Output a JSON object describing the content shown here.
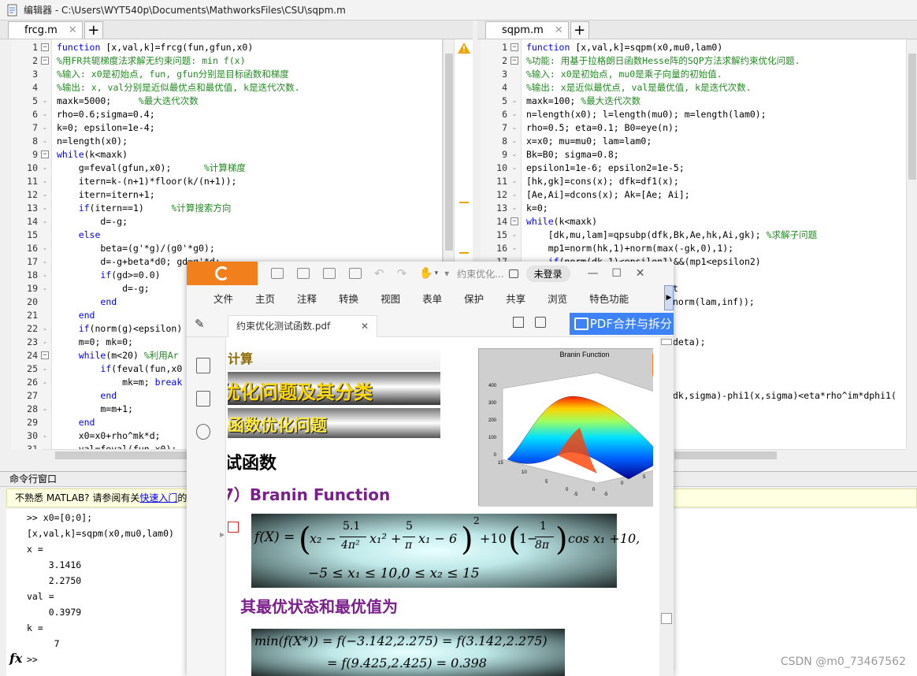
{
  "window": {
    "title": "编辑器 - C:\\Users\\WYT540p\\Documents\\MathworksFiles\\CSU\\sqpm.m"
  },
  "left_editor": {
    "tab": "frcg.m",
    "lines": [
      {
        "n": "1",
        "fold": "box",
        "t": [
          [
            "kw",
            "function"
          ],
          [
            "tx",
            " [x,val,k]=frcg(fun,gfun,x0)"
          ]
        ]
      },
      {
        "n": "2",
        "fold": "box",
        "t": [
          [
            "cm",
            "%用FR共轭梯度法求解无约束问题: min f(x)"
          ]
        ]
      },
      {
        "n": "3",
        "fold": "",
        "t": [
          [
            "cm",
            "%输入: x0是初始点, fun, gfun分别是目标函数和梯度"
          ]
        ]
      },
      {
        "n": "4",
        "fold": "",
        "t": [
          [
            "cm",
            "%输出: x, val分别是近似最优点和最优值, k是迭代次数."
          ]
        ]
      },
      {
        "n": "5",
        "fold": "dash",
        "t": [
          [
            "tx",
            "maxk=5000;     "
          ],
          [
            "cm",
            "%最大迭代次数"
          ]
        ]
      },
      {
        "n": "6",
        "fold": "dash",
        "t": [
          [
            "tx",
            "rho=0.6;sigma=0.4;"
          ]
        ]
      },
      {
        "n": "7",
        "fold": "dash",
        "t": [
          [
            "tx",
            "k=0; epsilon=1e-4;"
          ]
        ]
      },
      {
        "n": "8",
        "fold": "dash",
        "t": [
          [
            "tx",
            "n=length(x0);"
          ]
        ]
      },
      {
        "n": "9",
        "fold": "box",
        "t": [
          [
            "kw",
            "while"
          ],
          [
            "tx",
            "(k<maxk)"
          ]
        ]
      },
      {
        "n": "10",
        "fold": "dash",
        "t": [
          [
            "tx",
            "    g=feval(gfun,x0);      "
          ],
          [
            "cm",
            "%计算梯度"
          ]
        ]
      },
      {
        "n": "11",
        "fold": "dash",
        "t": [
          [
            "tx",
            "    itern=k-(n+1)*floor(k/(n+1));"
          ]
        ]
      },
      {
        "n": "12",
        "fold": "dash",
        "t": [
          [
            "tx",
            "    itern=itern+1;"
          ]
        ]
      },
      {
        "n": "13",
        "fold": "dash",
        "t": [
          [
            "tx",
            "    "
          ],
          [
            "kw",
            "if"
          ],
          [
            "tx",
            "(itern==1)     "
          ],
          [
            "cm",
            "%计算搜索方向"
          ]
        ]
      },
      {
        "n": "14",
        "fold": "dash",
        "t": [
          [
            "tx",
            "        d=-g;"
          ]
        ]
      },
      {
        "n": "15",
        "fold": "",
        "t": [
          [
            "tx",
            "    "
          ],
          [
            "kw",
            "else"
          ]
        ]
      },
      {
        "n": "16",
        "fold": "dash",
        "t": [
          [
            "tx",
            "        beta=(g'*g)/(g0'*g0);"
          ]
        ]
      },
      {
        "n": "17",
        "fold": "dash",
        "t": [
          [
            "tx",
            "        d=-g+beta*d0; gd=g'*d;"
          ]
        ]
      },
      {
        "n": "18",
        "fold": "dash",
        "t": [
          [
            "tx",
            "        "
          ],
          [
            "kw",
            "if"
          ],
          [
            "tx",
            "(gd>=0.0)"
          ]
        ]
      },
      {
        "n": "19",
        "fold": "dash",
        "t": [
          [
            "tx",
            "            d=-g;"
          ]
        ]
      },
      {
        "n": "20",
        "fold": "",
        "t": [
          [
            "tx",
            "        "
          ],
          [
            "kw",
            "end"
          ]
        ]
      },
      {
        "n": "21",
        "fold": "",
        "t": [
          [
            "tx",
            "    "
          ],
          [
            "kw",
            "end"
          ]
        ]
      },
      {
        "n": "22",
        "fold": "dash",
        "t": [
          [
            "tx",
            "    "
          ],
          [
            "kw",
            "if"
          ],
          [
            "tx",
            "(norm(g)<epsilon)"
          ]
        ]
      },
      {
        "n": "23",
        "fold": "dash",
        "t": [
          [
            "tx",
            "    m=0; mk=0;"
          ]
        ]
      },
      {
        "n": "24",
        "fold": "box",
        "t": [
          [
            "tx",
            "    "
          ],
          [
            "kw",
            "while"
          ],
          [
            "tx",
            "(m<20) "
          ],
          [
            "cm",
            "%利用Ar"
          ]
        ]
      },
      {
        "n": "25",
        "fold": "dash",
        "t": [
          [
            "tx",
            "        "
          ],
          [
            "kw",
            "if"
          ],
          [
            "tx",
            "(feval(fun,x0"
          ]
        ]
      },
      {
        "n": "26",
        "fold": "dash",
        "t": [
          [
            "tx",
            "            mk=m; "
          ],
          [
            "kw",
            "break"
          ]
        ]
      },
      {
        "n": "27",
        "fold": "",
        "t": [
          [
            "tx",
            "        "
          ],
          [
            "kw",
            "end"
          ]
        ]
      },
      {
        "n": "28",
        "fold": "dash",
        "t": [
          [
            "tx",
            "        m=m+1;"
          ]
        ]
      },
      {
        "n": "29",
        "fold": "",
        "t": [
          [
            "tx",
            "    "
          ],
          [
            "kw",
            "end"
          ]
        ]
      },
      {
        "n": "30",
        "fold": "dash",
        "t": [
          [
            "tx",
            "    x0=x0+rho^mk*d;"
          ]
        ]
      },
      {
        "n": "31",
        "fold": "dash",
        "t": [
          [
            "tx",
            "    val=feval(fun,x0);"
          ]
        ]
      }
    ]
  },
  "right_editor": {
    "tab": "sqpm.m",
    "lines": [
      {
        "n": "1",
        "fold": "box",
        "t": [
          [
            "kw",
            "function"
          ],
          [
            "tx",
            " [x,val,k]=sqpm(x0,mu0,lam0)"
          ]
        ]
      },
      {
        "n": "2",
        "fold": "box",
        "t": [
          [
            "cm",
            "%功能: 用基于拉格朗日函数Hesse阵的SQP方法求解约束优化问题."
          ]
        ]
      },
      {
        "n": "3",
        "fold": "",
        "t": [
          [
            "cm",
            "%输入: x0是初始点, mu0是乘子向量的初始值."
          ]
        ]
      },
      {
        "n": "4",
        "fold": "",
        "t": [
          [
            "cm",
            "%输出: x是近似最优点, val是最优值, k是迭代次数."
          ]
        ]
      },
      {
        "n": "5",
        "fold": "dash",
        "t": [
          [
            "tx",
            "maxk=100; "
          ],
          [
            "cm",
            "%最大迭代次数"
          ]
        ]
      },
      {
        "n": "6",
        "fold": "dash",
        "t": [
          [
            "tx",
            "n=length(x0); l=length(mu0); m=length(lam0);"
          ]
        ]
      },
      {
        "n": "7",
        "fold": "dash",
        "t": [
          [
            "tx",
            "rho=0.5; eta=0.1; B0=eye(n);"
          ]
        ]
      },
      {
        "n": "8",
        "fold": "dash",
        "t": [
          [
            "tx",
            "x=x0; mu=mu0; lam=lam0;"
          ]
        ]
      },
      {
        "n": "9",
        "fold": "dash",
        "t": [
          [
            "tx",
            "Bk=B0; sigma=0.8;"
          ]
        ]
      },
      {
        "n": "10",
        "fold": "dash",
        "t": [
          [
            "tx",
            "epsilon1=1e-6; epsilon2=1e-5;"
          ]
        ]
      },
      {
        "n": "11",
        "fold": "dash",
        "t": [
          [
            "tx",
            "[hk,gk]=cons(x); dfk=df1(x);"
          ]
        ]
      },
      {
        "n": "12",
        "fold": "dash",
        "t": [
          [
            "tx",
            "[Ae,Ai]=dcons(x); Ak=[Ae; Ai];"
          ]
        ]
      },
      {
        "n": "13",
        "fold": "dash",
        "t": [
          [
            "tx",
            "k=0;"
          ]
        ]
      },
      {
        "n": "14",
        "fold": "box",
        "t": [
          [
            "kw",
            "while"
          ],
          [
            "tx",
            "(k<maxk)"
          ]
        ]
      },
      {
        "n": "15",
        "fold": "dash",
        "t": [
          [
            "tx",
            "    [dk,mu,lam]=qpsubp(dfk,Bk,Ae,hk,Ai,gk); "
          ],
          [
            "cm",
            "%求解子问题"
          ]
        ]
      },
      {
        "n": "16",
        "fold": "dash",
        "t": [
          [
            "tx",
            "    mp1=norm(hk,1)+norm(max(-gk,0),1);"
          ]
        ]
      },
      {
        "n": "17",
        "fold": "dash",
        "t": [
          [
            "tx",
            "    "
          ],
          [
            "kw",
            "if"
          ],
          [
            "tx",
            "(norm(dk,1)<epsilon1)&&(mp1<epsilon2)"
          ]
        ]
      }
    ],
    "peek": [
      {
        "row": 19,
        "text": "t"
      },
      {
        "row": 20,
        "text": "norm(lam,inf));"
      },
      {
        "row": 23,
        "text": "deta);"
      },
      {
        "row": 27,
        "text": "dk,sigma)-phi1(x,sigma)<eta*rho^im*dphi1("
      }
    ]
  },
  "command_window": {
    "title": "命令行窗口",
    "banner_text": "不熟悉 MATLAB? 请参阅有关",
    "banner_link": "快速入门",
    "banner_tail": "的",
    "lines": [
      ">> x0=[0;0];",
      "[x,val,k]=sqpm(x0,mu0,lam0)",
      "x =",
      "    3.1416",
      "    2.2750",
      "val =",
      "    0.3979",
      "k =",
      "     7",
      ">>"
    ],
    "fx": "fx"
  },
  "pdf": {
    "app_name": "约束优化...",
    "login": "未登录",
    "menu": [
      "文件",
      "主页",
      "注释",
      "转换",
      "视图",
      "表单",
      "保护",
      "共享",
      "浏览",
      "特色功能"
    ],
    "doc_tab": "约束优化测试函数.pdf",
    "merge_button": "PDF合并与拆分",
    "slide": {
      "h0": "计算",
      "h1": "优化问题及其分类",
      "h2": "函数优化问题",
      "h3": "试函数",
      "h4": "7）Branin Function",
      "optimal_title": "其最优状态和最优值为"
    },
    "chart": {
      "title": "Branin Function",
      "z_ticks": [
        "400",
        "300",
        "200",
        "100",
        "0"
      ],
      "x_ticks": [
        "15",
        "10",
        "5",
        "0"
      ],
      "y_ticks": [
        "0",
        "5",
        "10"
      ],
      "extra_ticks": [
        "-5",
        "0",
        "-5"
      ]
    },
    "eq1": {
      "lhs": "f(X) =",
      "part_a": "x₂ − ",
      "frac1_num": "5.1",
      "frac1_den": "4π²",
      "part_b": "x₁² + ",
      "frac2_num": "5",
      "frac2_den": "π",
      "part_c": "x₁ − 6",
      "sq": "2",
      "part_d": "+10",
      "frac3_num": "1",
      "frac3_den": "8π",
      "one_minus": "1−",
      "part_e": "cos x₁ +10,",
      "constraint": "−5 ≤ x₁ ≤ 10,0 ≤ x₂ ≤ 15"
    },
    "eq2": {
      "line1": "min(f(X*)) = f(−3.142,2.275) = f(3.142,2.275)",
      "line2": "= f(9.425,2.425) = 0.398"
    }
  },
  "watermark": "CSDN @m0_73467562"
}
